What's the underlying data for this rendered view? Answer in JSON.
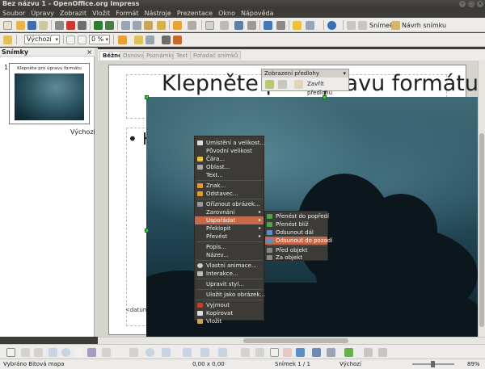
{
  "window": {
    "title": "Bez názvu 1 - OpenOffice.org Impress"
  },
  "menu": [
    "Soubor",
    "Úpravy",
    "Zobrazit",
    "Vložit",
    "Formát",
    "Nástroje",
    "Prezentace",
    "Okno",
    "Nápověda"
  ],
  "toolbar": {
    "slide_label": "Snímek",
    "design_label": "Návrh snímku"
  },
  "toolbar2": {
    "style_value": "Výchozí",
    "percent_value": "0 %"
  },
  "slides_pane": {
    "title": "Snímky",
    "slide_number": "1",
    "thumb_title": "Klepněte pro úpravu formátu",
    "slide_name": "Výchozí"
  },
  "tabs": [
    "Běžné",
    "Osnova",
    "Poznámky",
    "Text",
    "Pořadač snímků"
  ],
  "slide": {
    "title_text": "Klepněte pro úpravu formátu",
    "bullet_text": "• K",
    "date_text": "<datum/čas>"
  },
  "floating_toolbar": {
    "title": "Zobrazení předlohy",
    "close_label": "Zavřít předlohu"
  },
  "context_menu": [
    "Umístění a velikost...",
    "Původní velikost",
    "Čára...",
    "Oblast...",
    "Text...",
    "Znak...",
    "Odstavec...",
    "Oříznout obrázek...",
    "Zarovnání",
    "Uspořádat",
    "Překlopit",
    "Převést",
    "Popis...",
    "Název...",
    "Vlastní animace...",
    "Interakce...",
    "Upravit styl...",
    "Uložit jako obrázek...",
    "Vyjmout",
    "Kopírovat",
    "Vložit"
  ],
  "submenu": [
    "Přenést do popředí",
    "Přenést blíž",
    "Odsunout dál",
    "Odsunout do pozadí",
    "Před objekt",
    "Za objekt"
  ],
  "status": {
    "selection": "Vybráno Bitová mapa",
    "position": "0,00 x 0,00",
    "slide_of": "Snímek 1 / 1",
    "design": "Výchozí",
    "zoom": "89%"
  },
  "colors": {
    "highlight": "#c46a4a",
    "menu_bg": "#3c3b37"
  }
}
